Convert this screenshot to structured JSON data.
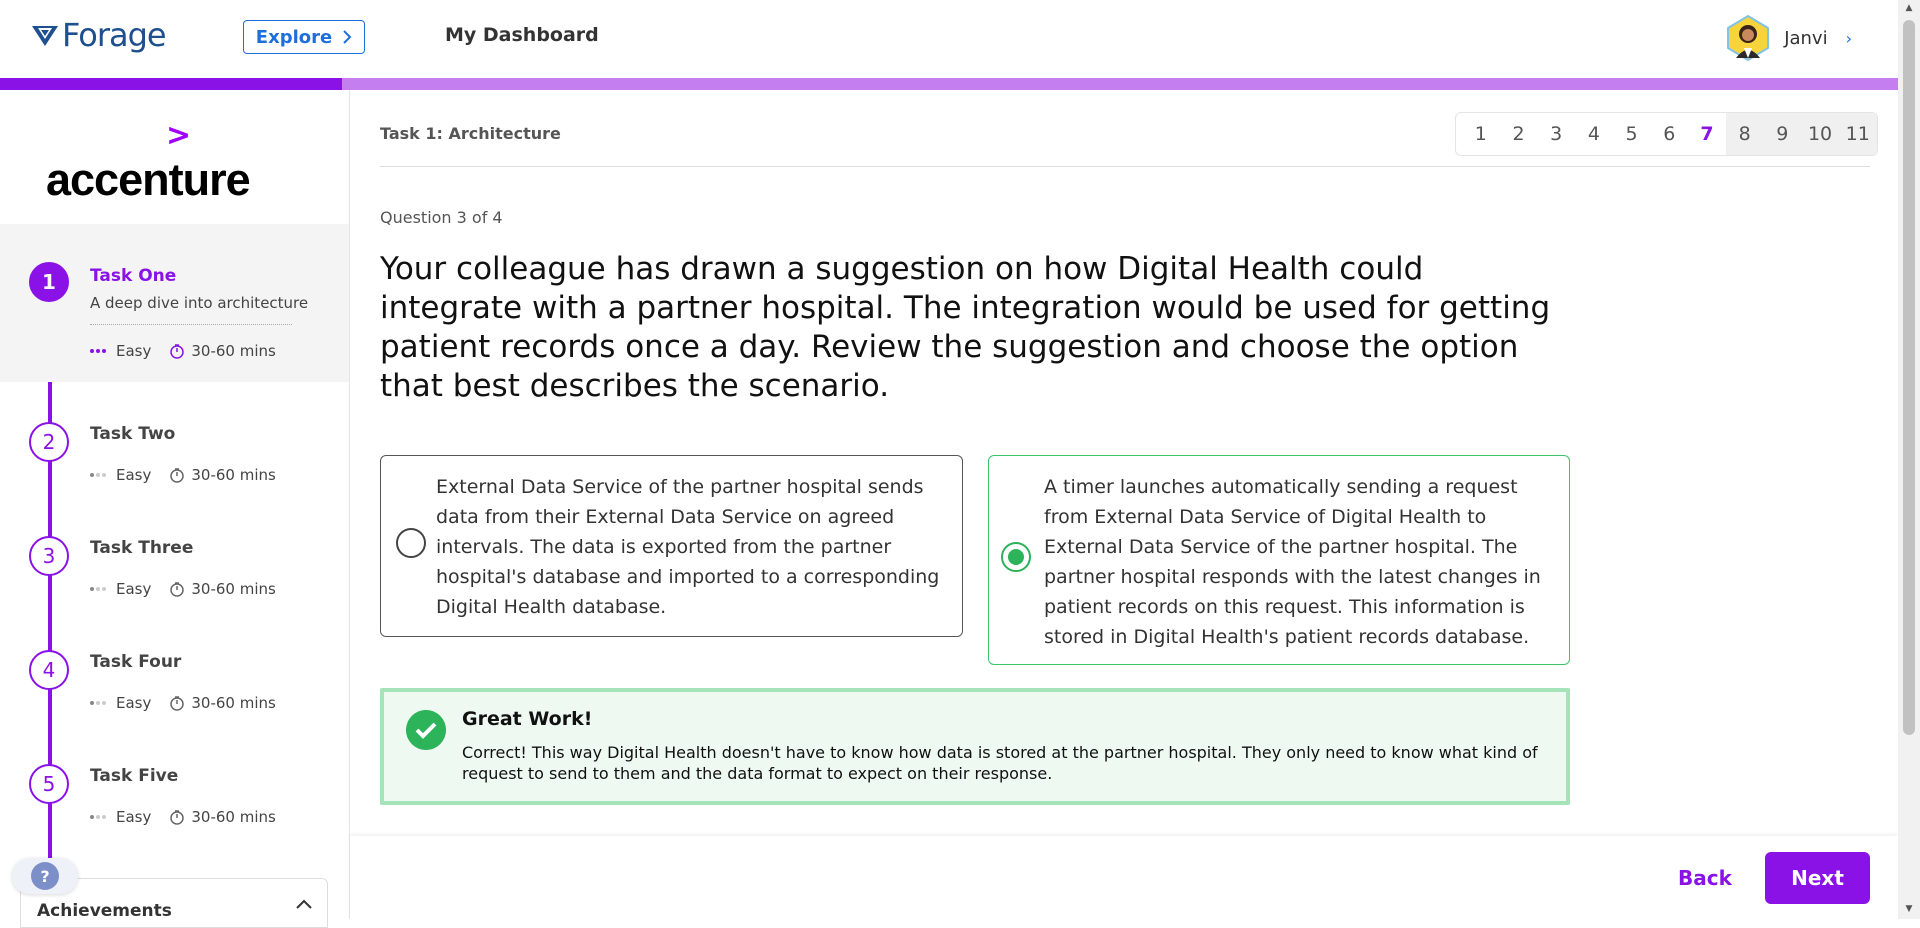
{
  "header": {
    "brand": "Forage",
    "explore_label": "Explore",
    "dashboard_label": "My Dashboard",
    "user_name": "Janvi"
  },
  "progress": {
    "fraction": 0.18
  },
  "sidebar": {
    "company": "accenture",
    "tasks": [
      {
        "num": "1",
        "title": "Task One",
        "desc": "A deep dive into architecture",
        "difficulty": "Easy",
        "duration": "30-60 mins",
        "active": true
      },
      {
        "num": "2",
        "title": "Task Two",
        "difficulty": "Easy",
        "duration": "30-60 mins"
      },
      {
        "num": "3",
        "title": "Task Three",
        "difficulty": "Easy",
        "duration": "30-60 mins"
      },
      {
        "num": "4",
        "title": "Task Four",
        "difficulty": "Easy",
        "duration": "30-60 mins"
      },
      {
        "num": "5",
        "title": "Task Five",
        "difficulty": "Easy",
        "duration": "30-60 mins"
      }
    ],
    "achievements_label": "Achievements",
    "help_label": "?"
  },
  "main": {
    "task_header": "Task 1: Architecture",
    "pages": [
      "1",
      "2",
      "3",
      "4",
      "5",
      "6",
      "7",
      "8",
      "9",
      "10",
      "11"
    ],
    "current_page": "7",
    "question_count": "Question 3 of 4",
    "question": "Your colleague has drawn a suggestion on how Digital Health could integrate with a partner hospital. The integration would be used for getting patient records once a day. Review the suggestion and choose the option that best describes the scenario.",
    "options": [
      {
        "text": "External Data Service of the partner hospital sends data from their External Data Service on agreed intervals. The data is exported from the partner hospital's database and imported to a corresponding Digital Health database.",
        "selected": false
      },
      {
        "text": "A timer launches automatically sending a request from External Data Service of Digital Health to External Data Service of the partner hospital. The partner hospital responds with the latest changes in patient records on this request. This information is stored in Digital Health's patient records database.",
        "selected": true
      }
    ],
    "feedback": {
      "title": "Great Work!",
      "text": "Correct! This way Digital Health doesn't have to know how data is stored at the partner hospital. They only need to know what kind of request to send to them and the data format to expect on their response."
    }
  },
  "footer": {
    "back_label": "Back",
    "next_label": "Next"
  },
  "colors": {
    "accent": "#8a12e6",
    "success": "#2db35a",
    "link": "#1e6fd9"
  }
}
